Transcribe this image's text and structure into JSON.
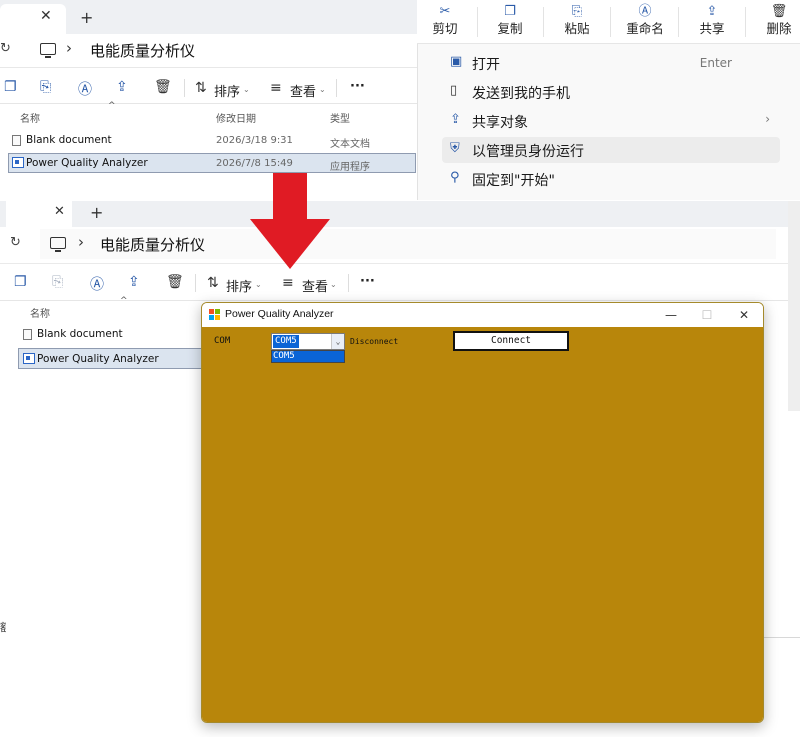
{
  "top_explorer": {
    "breadcrumb": "电能质量分析仪",
    "toolbar": {
      "sort_label": "排序",
      "view_label": "查看",
      "more_label": "···"
    },
    "columns": {
      "name": "名称",
      "modified": "修改日期",
      "type": "类型"
    },
    "rows": [
      {
        "name": "Blank document",
        "modified": "2026/3/18 9:31",
        "type": "文本文档"
      },
      {
        "name": "Power Quality Analyzer",
        "modified": "2026/7/8 15:49",
        "type": "应用程序"
      }
    ]
  },
  "context_menu": {
    "top_buttons": [
      {
        "label": "剪切",
        "icon": "cut-icon"
      },
      {
        "label": "复制",
        "icon": "copy-icon"
      },
      {
        "label": "粘贴",
        "icon": "paste-icon"
      },
      {
        "label": "重命名",
        "icon": "rename-icon"
      },
      {
        "label": "共享",
        "icon": "share-icon"
      },
      {
        "label": "删除",
        "icon": "delete-icon"
      }
    ],
    "items": [
      {
        "label": "打开",
        "shortcut": "Enter",
        "icon": "open-icon"
      },
      {
        "label": "发送到我的手机",
        "icon": "phone-icon"
      },
      {
        "label": "共享对象",
        "icon": "share-icon"
      },
      {
        "label": "以管理员身份运行",
        "icon": "shield-icon"
      },
      {
        "label": "固定到\"开始\"",
        "icon": "pin-icon"
      }
    ]
  },
  "bottom_explorer": {
    "breadcrumb": "电能质量分析仪",
    "toolbar": {
      "sort_label": "排序",
      "view_label": "查看",
      "more_label": "···"
    },
    "columns": {
      "name": "名称"
    },
    "rows": [
      {
        "name": "Blank document"
      },
      {
        "name": "Power Quality Analyzer"
      }
    ],
    "edge_char": "额"
  },
  "dialog": {
    "title": "Power Quality Analyzer",
    "com_label": "COM",
    "com_selected": "COM5",
    "com_options": [
      "COM5"
    ],
    "status_label": "Disconnect",
    "connect_button": "Connect",
    "body_color": "#b8860b"
  },
  "colors": {
    "arrow": "#e01b24",
    "accent": "#0a64d6",
    "selection": "#dbe4ef"
  }
}
